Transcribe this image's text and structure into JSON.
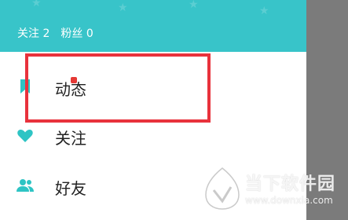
{
  "header": {
    "following_label": "关注",
    "following_count": "2",
    "followers_label": "粉丝",
    "followers_count": "0",
    "background_color": "#38c4c9"
  },
  "menu": {
    "items": [
      {
        "label": "动态",
        "icon": "bookmark-icon"
      },
      {
        "label": "关注",
        "icon": "heart-icon"
      },
      {
        "label": "好友",
        "icon": "people-icon"
      }
    ],
    "icon_color": "#2ec4c4"
  },
  "annotation": {
    "highlight_color": "#e8323c"
  },
  "watermark": {
    "title": "当下软件园",
    "url": "www.downxia.com"
  }
}
